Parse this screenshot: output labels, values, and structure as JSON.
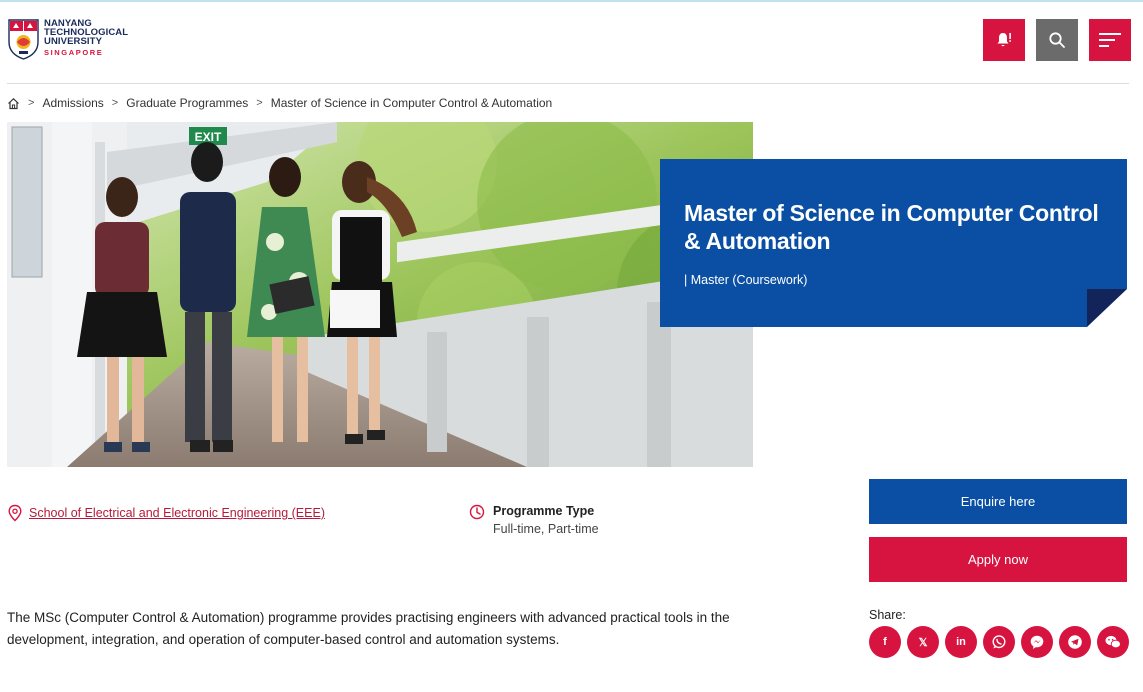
{
  "header": {
    "logo": {
      "line1": "NANYANG",
      "line2": "TECHNOLOGICAL",
      "line3": "UNIVERSITY",
      "line4": "SINGAPORE"
    },
    "icons": {
      "notify": "bell-alert-icon",
      "search": "search-icon",
      "menu": "hamburger-menu-icon"
    },
    "colors": {
      "primary_red": "#d71440",
      "navy": "#0a4fa3",
      "grey": "#6b6b6b"
    }
  },
  "breadcrumb": {
    "home_icon": "home-icon",
    "items": [
      "Admissions",
      "Graduate Programmes",
      "Master of Science in Computer Control & Automation"
    ]
  },
  "hero": {
    "title": "Master of Science in Computer Control & Automation",
    "subtitle": "| Master (Coursework)",
    "image_sign": "EXIT"
  },
  "info": {
    "school": "School of Electrical and Electronic Engineering (EEE)",
    "programme_type_label": "Programme Type",
    "programme_type_value": "Full-time, Part-time"
  },
  "actions": {
    "enquire": "Enquire here",
    "apply": "Apply now"
  },
  "description": "The MSc (Computer Control & Automation) programme provides practising engineers with advanced practical tools in the development, integration, and operation of computer-based control and automation systems.",
  "share": {
    "label": "Share:",
    "items": [
      {
        "name": "facebook",
        "glyph": "f"
      },
      {
        "name": "x",
        "glyph": "𝕏"
      },
      {
        "name": "linkedin",
        "glyph": "in"
      },
      {
        "name": "whatsapp",
        "glyph": ""
      },
      {
        "name": "messenger",
        "glyph": ""
      },
      {
        "name": "telegram",
        "glyph": ""
      },
      {
        "name": "wechat",
        "glyph": ""
      }
    ]
  }
}
